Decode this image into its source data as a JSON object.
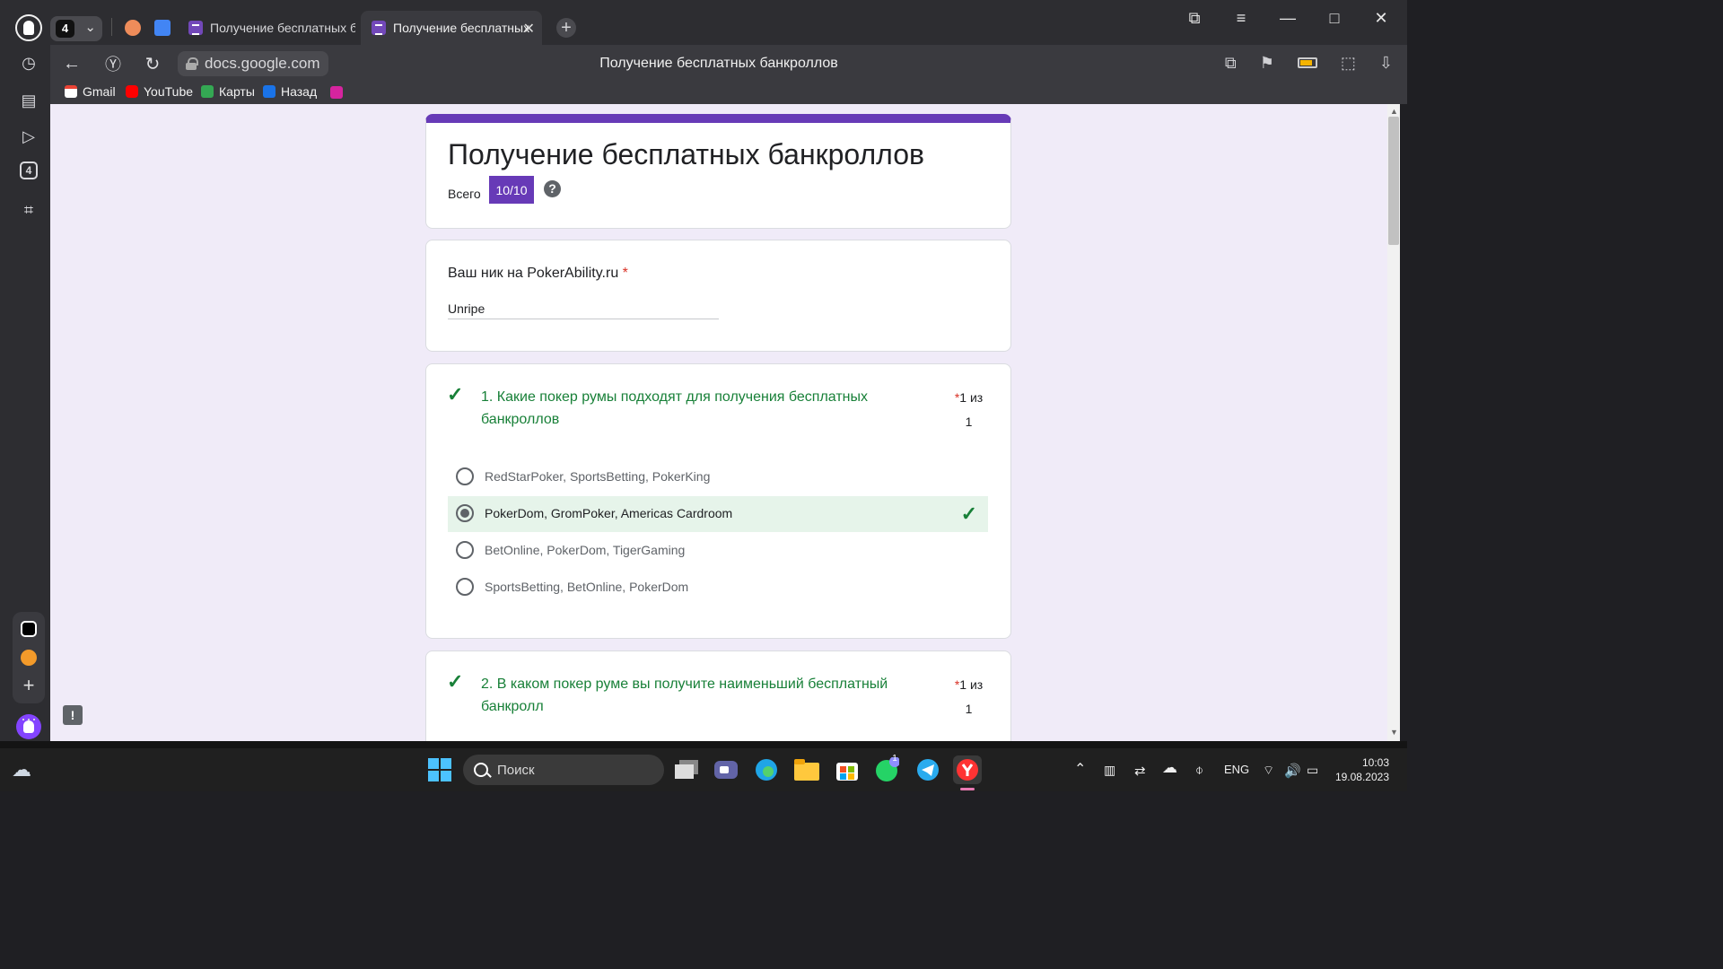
{
  "browser": {
    "tabs_count": "4",
    "tabs": [
      {
        "title": "Получение бесплатных ба",
        "active": false
      },
      {
        "title": "Получение бесплатных",
        "active": true
      }
    ],
    "address": "docs.google.com",
    "page_title": "Получение бесплатных банкроллов"
  },
  "bookmarks": [
    {
      "label": "Gmail"
    },
    {
      "label": "YouTube"
    },
    {
      "label": "Карты"
    },
    {
      "label": "Назад"
    }
  ],
  "sidebar": {
    "tabs_badge": "4"
  },
  "form": {
    "title": "Получение бесплатных банкроллов",
    "total_label": "Всего",
    "score": "10/10",
    "help": "?",
    "nick_question": "Ваш ник на PokerAbility.ru",
    "nick_asterisk": "*",
    "nick_answer": "Unripe",
    "questions": [
      {
        "text": "1. Какие покер румы подходят для получения бесплатных банкроллов",
        "points_top": "1 из",
        "points_bottom": "1",
        "options": [
          {
            "label": "RedStarPoker, SportsBetting, PokerKing"
          },
          {
            "label": "PokerDom, GromPoker, Americas Cardroom"
          },
          {
            "label": "BetOnline, PokerDom, TigerGaming"
          },
          {
            "label": "SportsBetting, BetOnline, PokerDom"
          }
        ]
      },
      {
        "text": "2. В каком покер руме вы получите наименьший бесплатный банкролл",
        "points_top": "1 из",
        "points_bottom": "1"
      }
    ]
  },
  "taskbar": {
    "search": "Поиск",
    "whatsapp_badge": "1",
    "language": "ENG",
    "time": "10:03",
    "date": "19.08.2023"
  },
  "colors": {
    "form_accent": "#673ab7",
    "correct_green": "#188038",
    "correct_bg": "#e6f4ea",
    "page_bg": "#f0ebf8"
  }
}
